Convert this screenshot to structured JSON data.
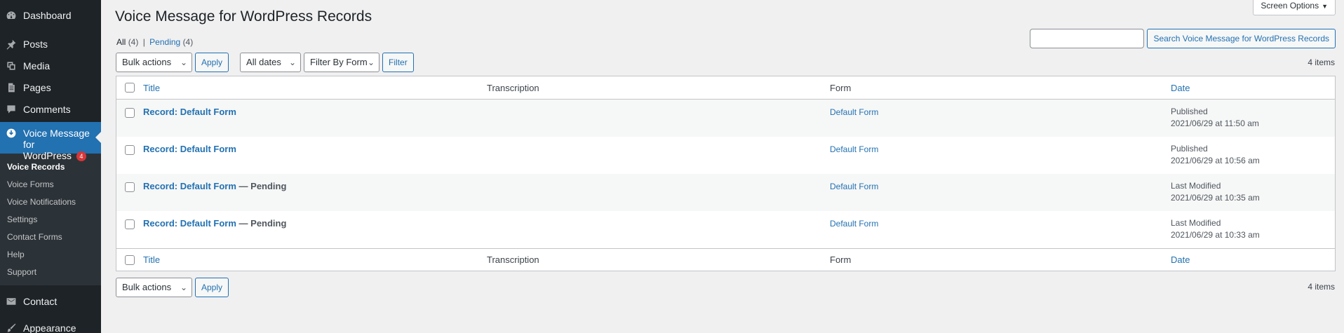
{
  "sidebar": {
    "menu": [
      {
        "label": "Dashboard",
        "icon": "dashboard-icon"
      },
      {
        "label": "Posts",
        "icon": "pin-icon"
      },
      {
        "label": "Media",
        "icon": "media-icon"
      },
      {
        "label": "Pages",
        "icon": "pages-icon"
      },
      {
        "label": "Comments",
        "icon": "comments-icon"
      }
    ],
    "current": {
      "label_line1": "Voice Message for",
      "label_line2": "WordPress",
      "badge": "4",
      "icon": "voice-icon"
    },
    "submenu": [
      "Voice Records",
      "Voice Forms",
      "Voice Notifications",
      "Settings",
      "Contact Forms",
      "Help",
      "Support"
    ],
    "menu_after": [
      {
        "label": "Contact",
        "icon": "mail-icon"
      },
      {
        "label": "Appearance",
        "icon": "brush-icon"
      }
    ]
  },
  "header": {
    "title": "Voice Message for WordPress Records",
    "screen_options": "Screen Options"
  },
  "filters": {
    "all_label": "All",
    "all_count": "(4)",
    "separator": "|",
    "pending_label": "Pending",
    "pending_count": "(4)"
  },
  "search": {
    "value": "",
    "button": "Search Voice Message for WordPress Records"
  },
  "tablenav_top": {
    "bulk_actions": "Bulk actions",
    "apply": "Apply",
    "dates": "All dates",
    "form_filter": "Filter By Form",
    "filter": "Filter",
    "count": "4 items"
  },
  "table": {
    "columns": {
      "title": "Title",
      "transcription": "Transcription",
      "form": "Form",
      "date": "Date"
    },
    "rows": [
      {
        "title": "Record: Default Form",
        "state": "",
        "transcription": "",
        "form": "Default Form",
        "status": "Published",
        "date": "2021/06/29 at 11:50 am"
      },
      {
        "title": "Record: Default Form",
        "state": "",
        "transcription": "",
        "form": "Default Form",
        "status": "Published",
        "date": "2021/06/29 at 10:56 am"
      },
      {
        "title": "Record: Default Form",
        "state": "— Pending",
        "transcription": "",
        "form": "Default Form",
        "status": "Last Modified",
        "date": "2021/06/29 at 10:35 am"
      },
      {
        "title": "Record: Default Form",
        "state": "— Pending",
        "transcription": "",
        "form": "Default Form",
        "status": "Last Modified",
        "date": "2021/06/29 at 10:33 am"
      }
    ]
  },
  "tablenav_bottom": {
    "bulk_actions": "Bulk actions",
    "apply": "Apply",
    "count": "4 items"
  },
  "colors": {
    "sidebar_bg": "#1d2327",
    "accent": "#2271b1",
    "badge": "#d63638",
    "page_bg": "#f0f0f1"
  }
}
